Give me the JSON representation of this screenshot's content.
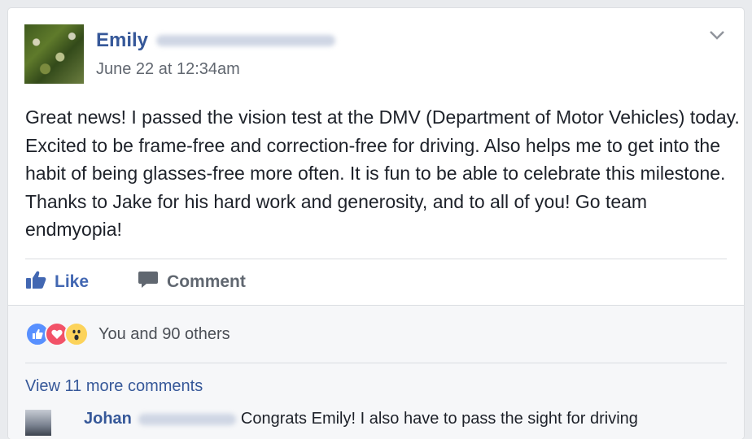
{
  "post": {
    "author_first_name": "Emily",
    "timestamp": "June 22 at 12:34am",
    "text": "Great news! I passed the vision test at the DMV (Department of Motor Vehicles) today. Excited to be frame-free and correction-free for driving. Also helps me to get into the habit of being glasses-free more often. It is fun to be able to celebrate this milestone. Thanks to Jake for his hard work and generosity, and to all of you! Go team endmyopia!"
  },
  "actions": {
    "like_label": "Like",
    "comment_label": "Comment"
  },
  "reactions": {
    "icons": [
      "like-icon",
      "love-icon",
      "wow-icon"
    ],
    "summary": "You and 90 others"
  },
  "comments": {
    "view_more_label": "View 11 more comments",
    "items": [
      {
        "author_first_name": "Johan",
        "text": "Congrats Emily! I also have to pass the sight for driving"
      }
    ]
  },
  "colors": {
    "link_blue": "#365899",
    "like_blue": "#4267b2",
    "text": "#1d2129",
    "muted": "#616770",
    "feedback_bg": "#f6f7f9"
  }
}
